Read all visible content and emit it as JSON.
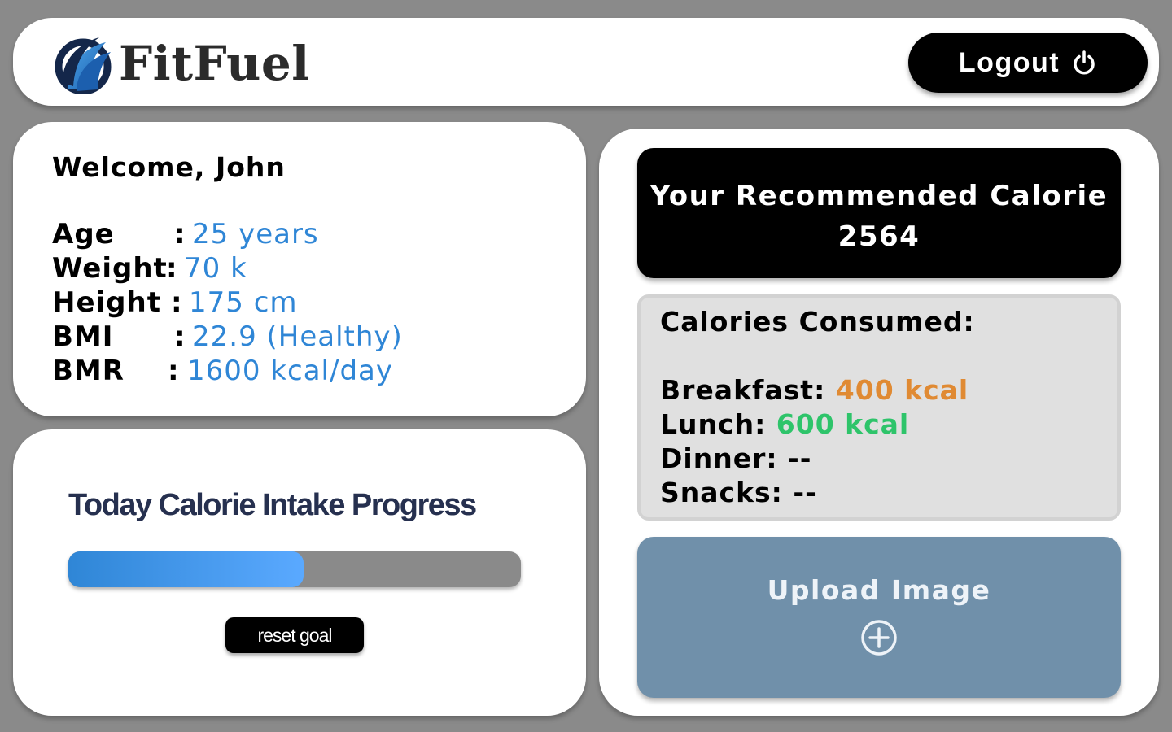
{
  "app": {
    "name": "FitFuel",
    "logout_label": "Logout",
    "logout_icon": "power-icon"
  },
  "profile": {
    "welcome": "Welcome, John",
    "stats": [
      {
        "label": "Age",
        "value": "25 years"
      },
      {
        "label": "Weight",
        "value": "70 k"
      },
      {
        "label": "Height",
        "value": "175 cm"
      },
      {
        "label": "BMI",
        "value": "22.9 (Healthy)"
      },
      {
        "label": "BMR",
        "value": "1600 kcal/day"
      }
    ]
  },
  "progress": {
    "title": "Today Calorie Intake Progress",
    "fraction": 0.52,
    "reset_label": "reset goal"
  },
  "recommendation": {
    "label": "Your Recommended Calorie",
    "value": "2564"
  },
  "consumed": {
    "title": "Calories Consumed:",
    "meals": [
      {
        "label": "Breakfast:",
        "value": "400 kcal"
      },
      {
        "label": "Lunch:",
        "value": "600 kcal"
      },
      {
        "label": "Dinner:",
        "value": "--"
      },
      {
        "label": "Snacks:",
        "value": "--"
      }
    ]
  },
  "upload": {
    "label": "Upload Image",
    "icon": "plus-circle-icon"
  },
  "colors": {
    "accent_blue": "#2f86d6",
    "breakfast_orange": "#e08a33",
    "lunch_green": "#2ec46a",
    "upload_bg": "#7090aa"
  }
}
